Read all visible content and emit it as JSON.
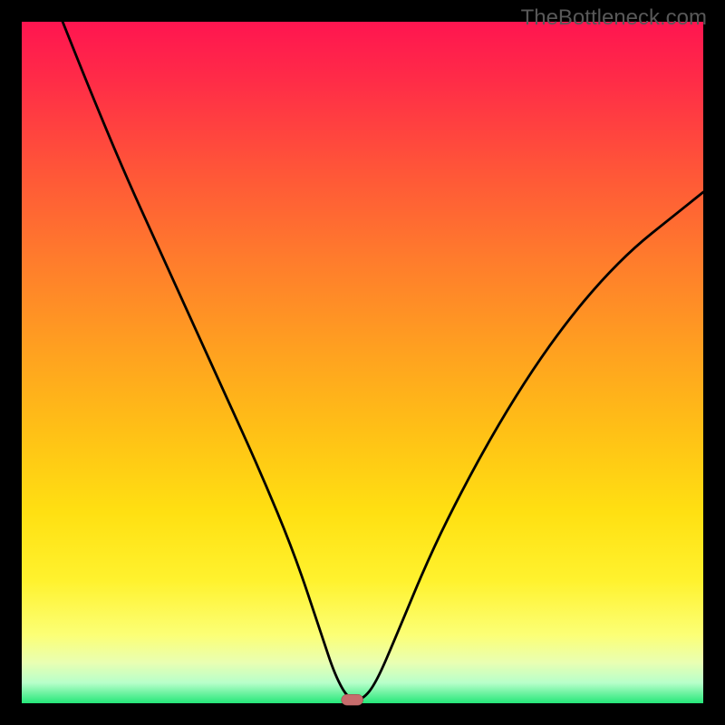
{
  "watermark": {
    "text": "TheBottleneck.com"
  },
  "chart_data": {
    "type": "line",
    "title": "",
    "xlabel": "",
    "ylabel": "",
    "xlim": [
      0,
      100
    ],
    "ylim": [
      0,
      100
    ],
    "background_gradient": [
      {
        "stop": 0,
        "color": "#ff1550"
      },
      {
        "stop": 8,
        "color": "#ff2a48"
      },
      {
        "stop": 22,
        "color": "#ff5638"
      },
      {
        "stop": 35,
        "color": "#ff7c2c"
      },
      {
        "stop": 48,
        "color": "#ffa020"
      },
      {
        "stop": 60,
        "color": "#ffc016"
      },
      {
        "stop": 72,
        "color": "#ffe012"
      },
      {
        "stop": 82,
        "color": "#fff22e"
      },
      {
        "stop": 90,
        "color": "#fcff76"
      },
      {
        "stop": 94,
        "color": "#e9ffb2"
      },
      {
        "stop": 97,
        "color": "#b8ffca"
      },
      {
        "stop": 100,
        "color": "#24e779"
      }
    ],
    "series": [
      {
        "name": "bottleneck-curve",
        "x": [
          6,
          10,
          15,
          20,
          25,
          30,
          35,
          40,
          44,
          46,
          48,
          50,
          52,
          55,
          60,
          65,
          70,
          75,
          80,
          85,
          90,
          95,
          100
        ],
        "y": [
          100,
          90,
          78,
          67,
          56,
          45,
          34,
          22,
          10,
          4,
          0.5,
          0.5,
          3,
          10,
          22,
          32,
          41,
          49,
          56,
          62,
          67,
          71,
          75
        ]
      }
    ],
    "marker": {
      "x": 48.5,
      "y": 0.5,
      "shape": "rounded-rect",
      "color": "#c76c6c"
    }
  }
}
